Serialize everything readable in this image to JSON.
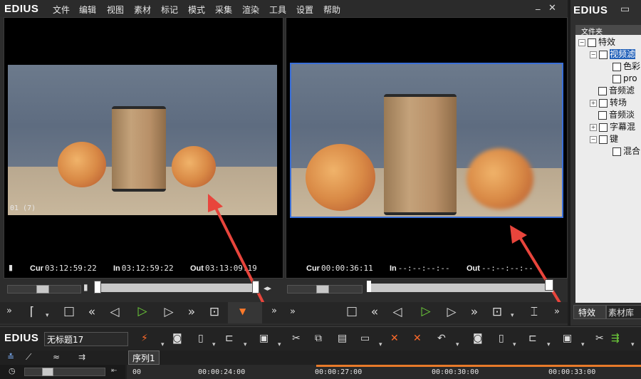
{
  "app": {
    "name": "EDIUS"
  },
  "menu": {
    "items": [
      "文件",
      "编辑",
      "视图",
      "素材",
      "标记",
      "模式",
      "采集",
      "渲染",
      "工具",
      "设置",
      "帮助"
    ]
  },
  "window_controls": {
    "minimize": "_",
    "close": "✕"
  },
  "player": {
    "frame_label": "01 (7)",
    "cur_label": "Cur",
    "cur": "03:12:59:22",
    "in_label": "In",
    "in": "03:12:59:22",
    "out_label": "Out",
    "out": "03:13:09:19"
  },
  "recorder": {
    "cur_label": "Cur",
    "cur": "00:00:36:11",
    "in_label": "In",
    "in": "--:--:--:--",
    "out_label": "Out",
    "out": "--:--:--:--"
  },
  "bin": {
    "title": "EDIUS",
    "header": "文件夹",
    "tree": [
      {
        "label": "特效",
        "level": 0
      },
      {
        "label": "视频滤",
        "level": 1,
        "selected": true
      },
      {
        "label": "色彩",
        "level": 2
      },
      {
        "label": "pro",
        "level": 2
      },
      {
        "label": "音频滤",
        "level": 1
      },
      {
        "label": "转场",
        "level": 1
      },
      {
        "label": "音频淡",
        "level": 1
      },
      {
        "label": "字幕混",
        "level": 1
      },
      {
        "label": "键",
        "level": 1
      },
      {
        "label": "混合",
        "level": 2
      }
    ],
    "tabs": [
      "特效",
      "素材库"
    ]
  },
  "timeline": {
    "brand": "EDIUS",
    "project_name": "无标题17",
    "sequence_tab": "序列1",
    "ruler": [
      "00",
      "00:00:24:00",
      "00:00:27:00",
      "00:00:30:00",
      "00:00:33:00"
    ]
  }
}
